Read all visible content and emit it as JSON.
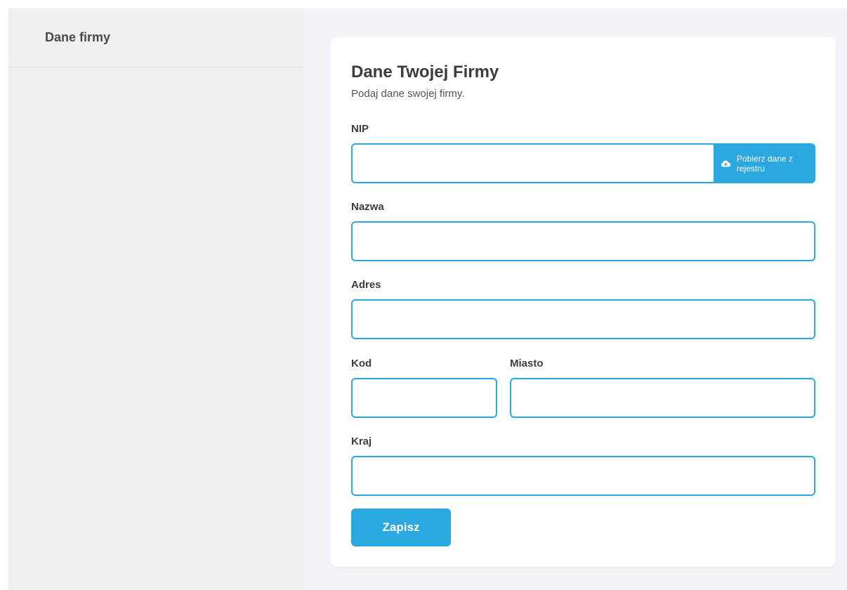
{
  "sidebar": {
    "title": "Dane firmy"
  },
  "card": {
    "title": "Dane Twojej Firmy",
    "subtitle": "Podaj dane swojej firmy."
  },
  "form": {
    "nip": {
      "label": "NIP",
      "value": ""
    },
    "fetch_button": {
      "label": "Pobierz dane z rejestru",
      "icon": "cloud-download-icon"
    },
    "nazwa": {
      "label": "Nazwa",
      "value": ""
    },
    "adres": {
      "label": "Adres",
      "value": ""
    },
    "kod": {
      "label": "Kod",
      "value": ""
    },
    "miasto": {
      "label": "Miasto",
      "value": ""
    },
    "kraj": {
      "label": "Kraj",
      "value": ""
    },
    "save_label": "Zapisz"
  },
  "colors": {
    "accent": "#2aa8df",
    "sidebar_bg": "#efefef",
    "main_bg": "#f3f4f7",
    "card_bg": "#ffffff"
  }
}
